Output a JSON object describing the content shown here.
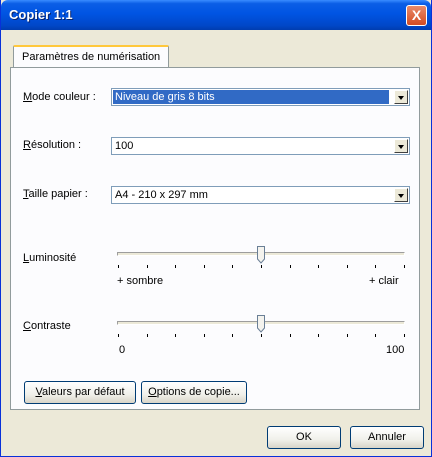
{
  "window": {
    "title": "Copier 1:1",
    "close_glyph": "X"
  },
  "tab": {
    "label": "Paramètres de numérisation"
  },
  "fields": {
    "mode": {
      "label_first": "M",
      "label_rest": "ode couleur :",
      "value": "Niveau de gris 8 bits"
    },
    "resolution": {
      "label_first": "R",
      "label_rest": "ésolution :",
      "value": "100"
    },
    "paper": {
      "label_first": "T",
      "label_rest": "aille papier :",
      "value": "A4 - 210 x 297 mm"
    }
  },
  "brightness": {
    "label_first": "L",
    "label_rest": "uminosité",
    "min_label": "+ sombre",
    "max_label": "+ clair",
    "value_fraction": 0.5
  },
  "contrast": {
    "label_first": "C",
    "label_rest": "ontraste",
    "min_label": "0",
    "max_label": "100",
    "value_fraction": 0.5
  },
  "buttons": {
    "defaults": {
      "first": "V",
      "rest": "aleurs par défaut"
    },
    "copy_options": {
      "first": "O",
      "rest": "ptions de copie..."
    },
    "ok": "OK",
    "cancel": "Annuler"
  }
}
